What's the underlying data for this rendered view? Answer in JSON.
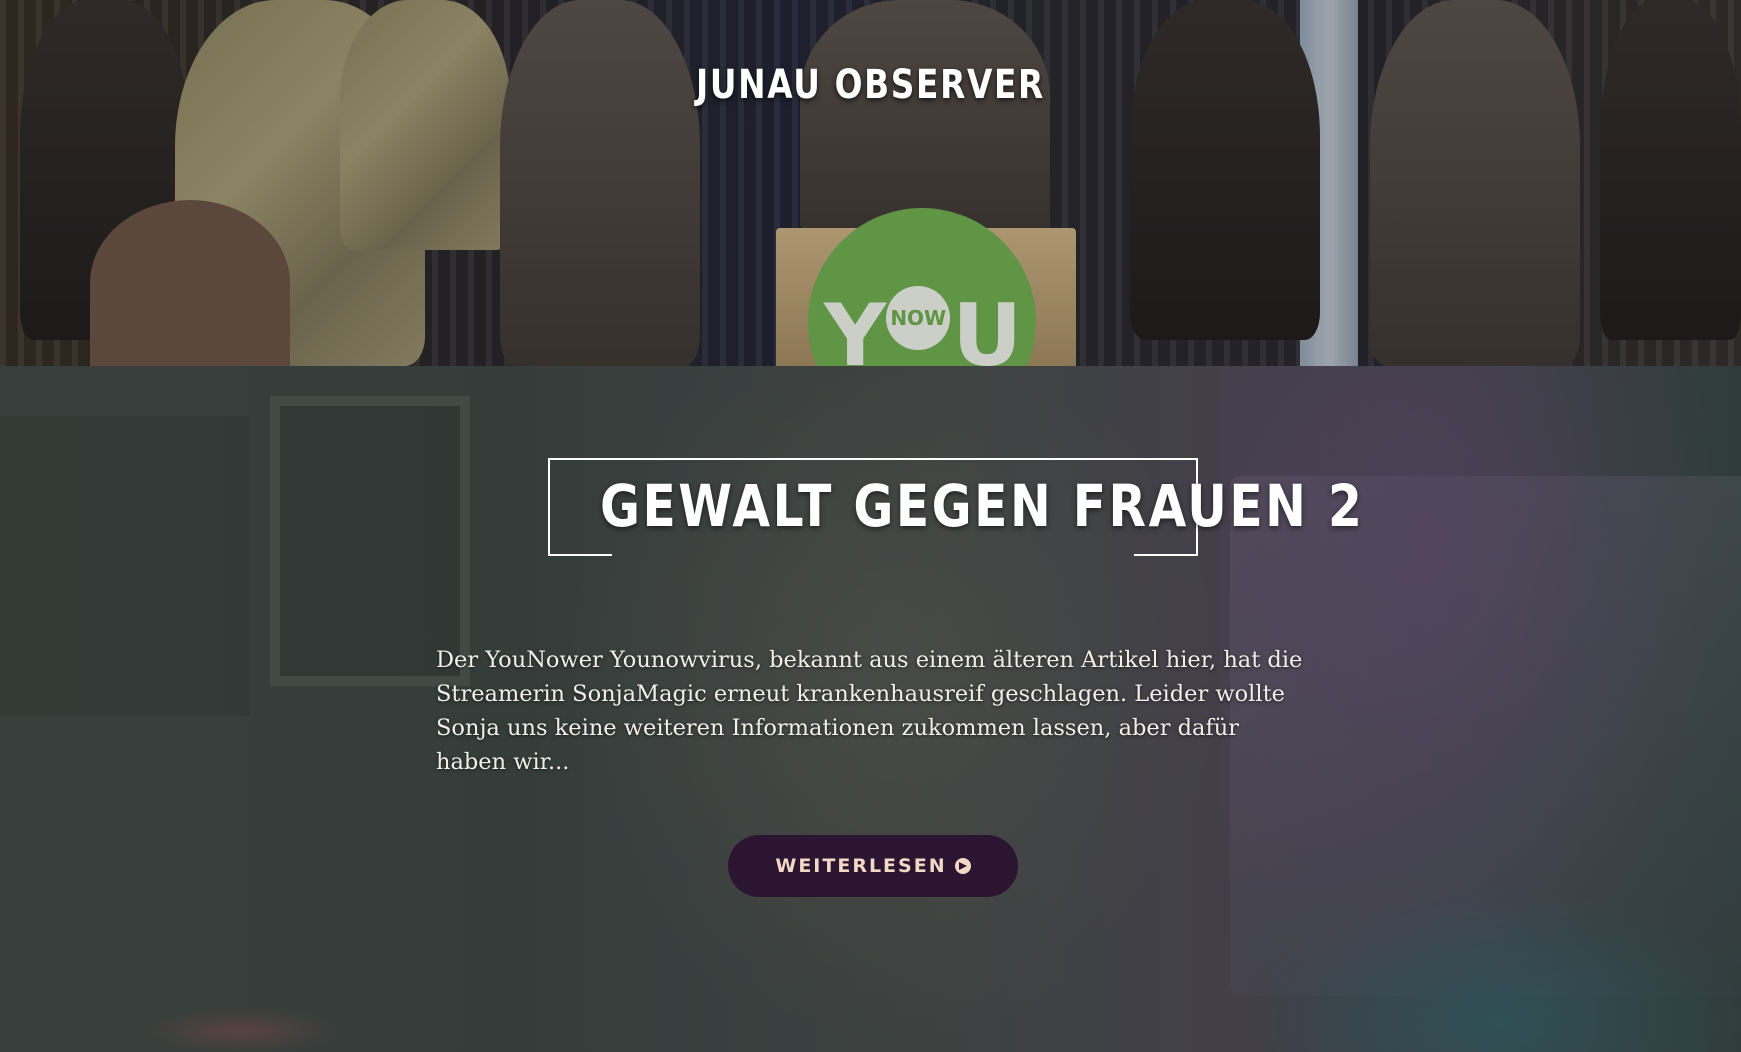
{
  "site": {
    "title": "JUNAU OBSERVER"
  },
  "hero_image": {
    "description_logo_text": "YOU",
    "logo_badge": "NOW",
    "logo_color": "#6fb24f"
  },
  "post": {
    "title": "GEWALT GEGEN FRAUEN 2",
    "excerpt": "Der YouNower Younowvirus, bekannt aus einem älteren Artikel hier, hat die Streamerin SonjaMagic erneut krankenhausreif geschlagen. Leider wollte Sonja uns keine weiteren Informationen zukommen lassen, aber dafür haben wir...",
    "read_more_label": "WEITERLESEN",
    "read_more_icon": "arrow-circle-right-icon"
  },
  "colors": {
    "button_bg": "#2c1530",
    "button_text": "#f3d9c5",
    "title_text": "#ffffff"
  }
}
